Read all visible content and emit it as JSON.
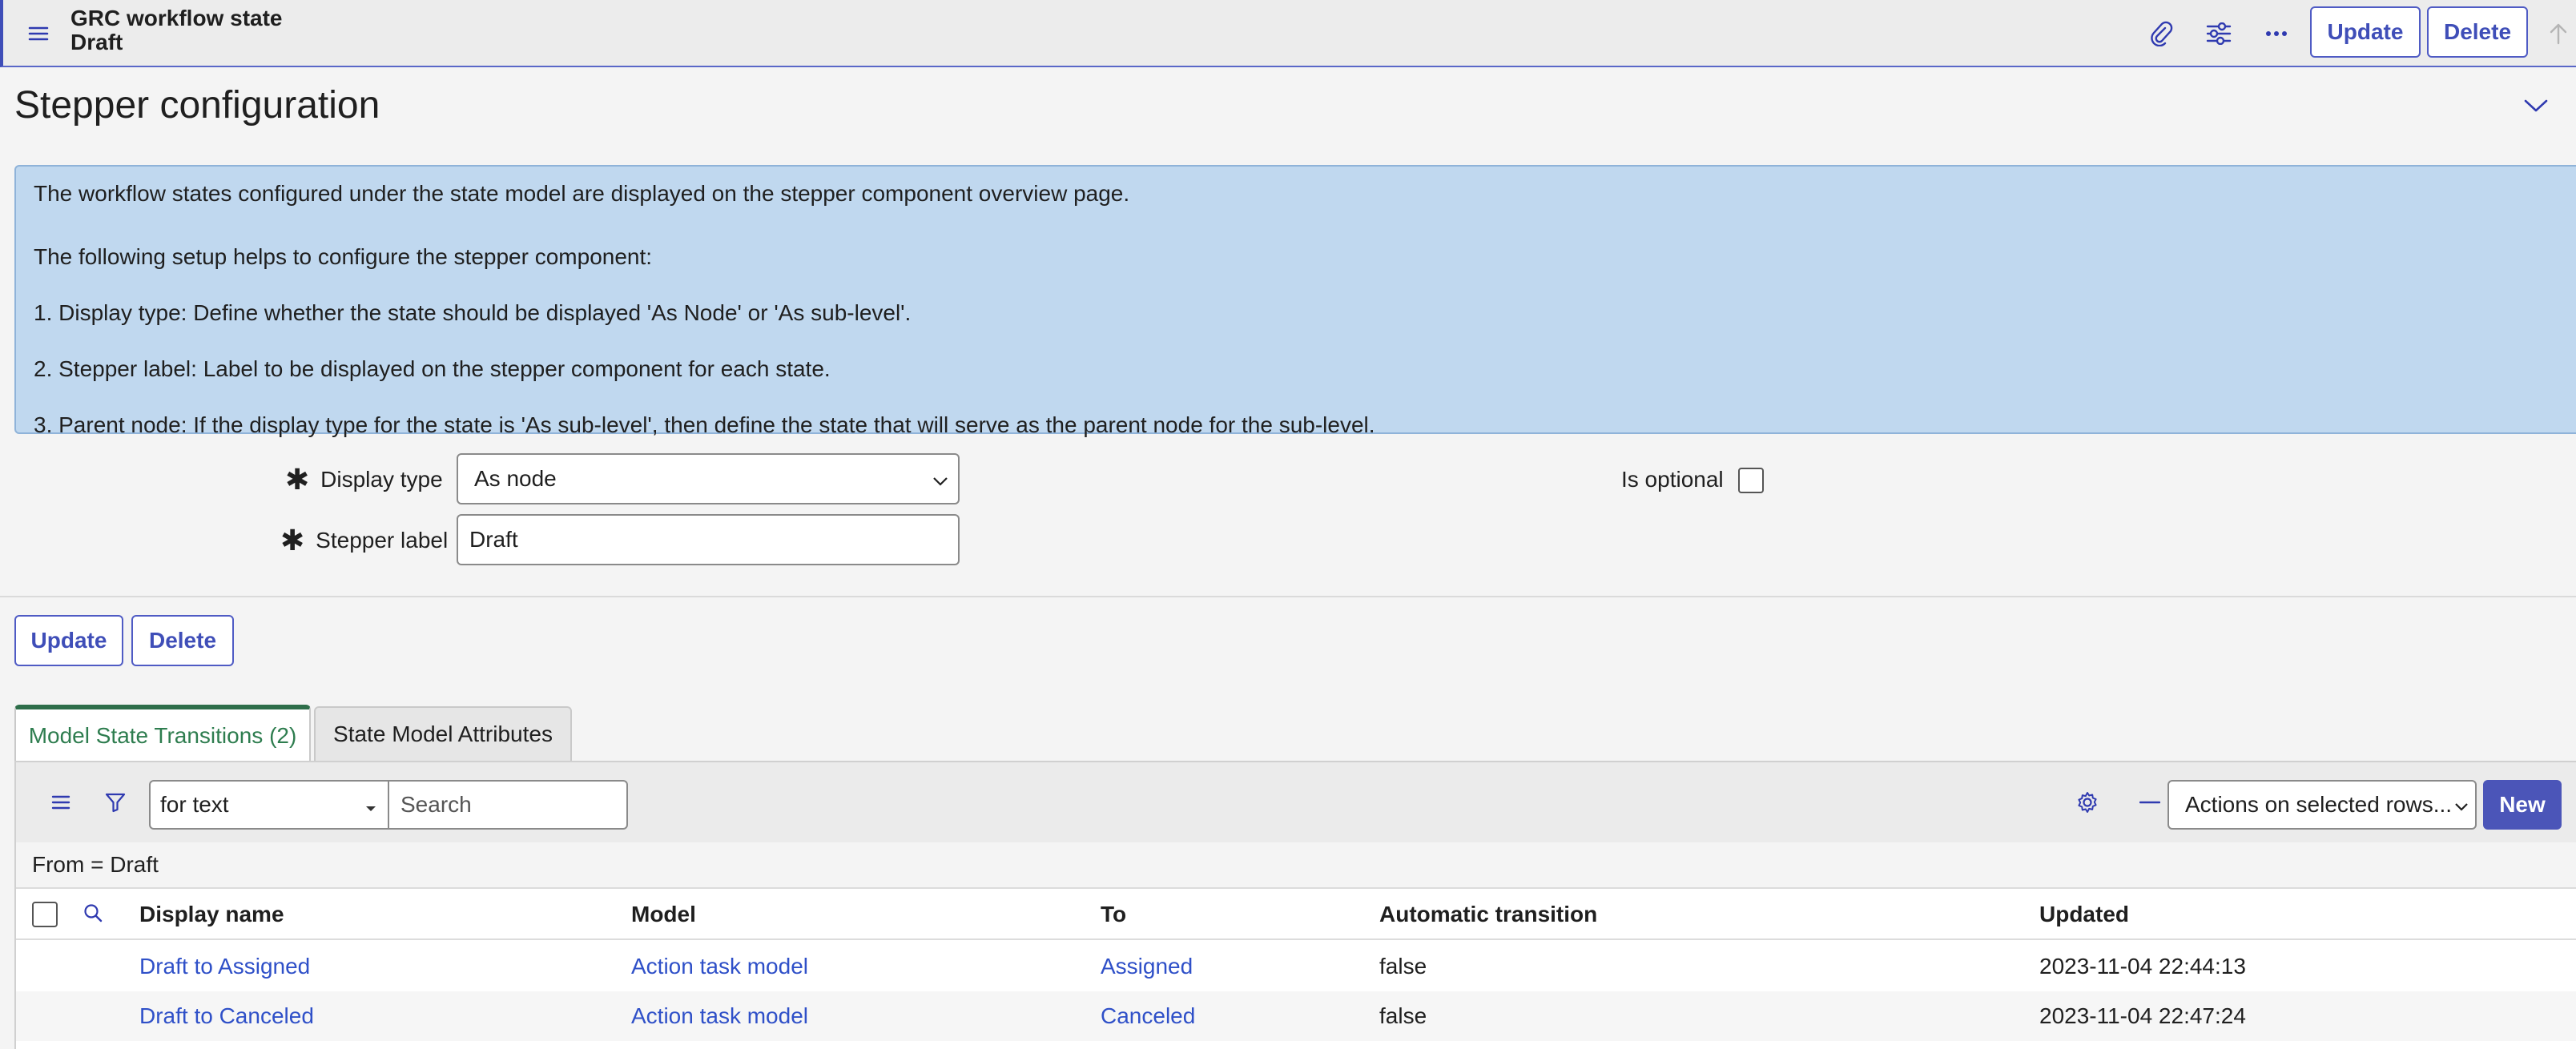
{
  "header": {
    "title": "GRC workflow state",
    "subtitle": "Draft",
    "update_label": "Update",
    "delete_label": "Delete"
  },
  "section": {
    "title": "Stepper configuration"
  },
  "info": {
    "lines": [
      "The workflow states configured under the state model are displayed on the stepper component overview page.",
      "The following setup helps to configure the stepper component:",
      "1. Display type: Define whether the state should be displayed 'As Node' or 'As sub-level'.",
      "2. Stepper label: Label to be displayed on the stepper component for each state.",
      "3. Parent node: If the display type for the state is 'As sub-level', then define the state that will serve as the parent node for the sub-level."
    ]
  },
  "form": {
    "display_type_label": "Display type",
    "display_type_value": "As node",
    "stepper_label_label": "Stepper label",
    "stepper_label_value": "Draft",
    "is_optional_label": "Is optional",
    "is_optional_checked": false,
    "update_label": "Update",
    "delete_label": "Delete"
  },
  "tabs": [
    {
      "label": "Model State Transitions (2)",
      "active": true
    },
    {
      "label": "State Model Attributes",
      "active": false
    }
  ],
  "list": {
    "search_field_option": "for text",
    "search_placeholder": "Search",
    "actions_label": "Actions on selected rows...",
    "new_label": "New",
    "filter_breadcrumb": "From = Draft",
    "columns": [
      "Display name",
      "Model",
      "To",
      "Automatic transition",
      "Updated"
    ],
    "rows": [
      {
        "display_name": "Draft to Assigned",
        "model": "Action task model",
        "to": "Assigned",
        "automatic_transition": "false",
        "updated": "2023-11-04 22:44:13"
      },
      {
        "display_name": "Draft to Canceled",
        "model": "Action task model",
        "to": "Canceled",
        "automatic_transition": "false",
        "updated": "2023-11-04 22:47:24"
      }
    ]
  },
  "colors": {
    "accent": "#3f4eb8",
    "info_bg": "#c0d8ef",
    "link": "#2f50c8",
    "active_tab": "#2e7d4f"
  }
}
